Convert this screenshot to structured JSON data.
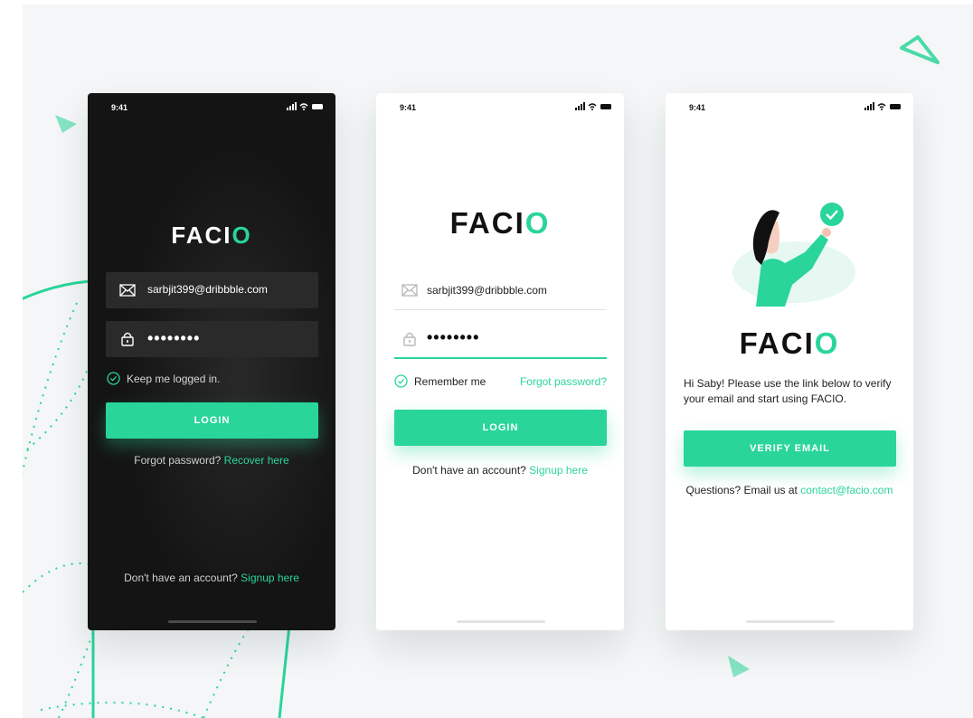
{
  "status": {
    "time": "9:41"
  },
  "brand": {
    "name_prefix": "FACI",
    "name_suffix": "O",
    "accent_color": "#2ad59a"
  },
  "screen_login_dark": {
    "email_value": "sarbjit399@dribbble.com",
    "password_mask": "••••••••",
    "keep_logged_label": "Keep me logged in.",
    "login_button": "LOGIN",
    "forgot_prefix": "Forgot password?",
    "forgot_link": "Recover here",
    "signup_prefix": "Don't have an account?",
    "signup_link": "Signup here"
  },
  "screen_login_light": {
    "email_value": "sarbjit399@dribbble.com",
    "password_mask": "••••••••",
    "remember_label": "Remember me",
    "forgot_link": "Forgot password?",
    "login_button": "LOGIN",
    "signup_prefix": "Don't have an account?",
    "signup_link": "Signup here"
  },
  "screen_verify": {
    "message": "Hi Saby! Please use the link below to verify your email and start using FACIO.",
    "verify_button": "VERIFY EMAIL",
    "questions_prefix": "Questions? Email us at",
    "contact_email": "contact@facio.com"
  }
}
